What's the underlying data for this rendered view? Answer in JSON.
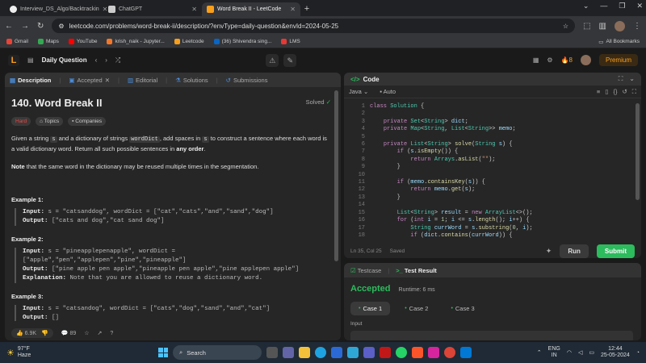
{
  "browser": {
    "tabs": [
      {
        "title": "Interview_DS_Algo/Backtrackin",
        "favicon_color": "#eeeeee",
        "active": false
      },
      {
        "title": "ChatGPT",
        "favicon_color": "#cccccc",
        "active": false
      },
      {
        "title": "Word Break II - LeetCode",
        "favicon_color": "#f89f1b",
        "active": true
      }
    ],
    "url": "leetcode.com/problems/word-break-ii/description/?envType=daily-question&envId=2024-05-25",
    "bookmarks": [
      {
        "label": "Gmail",
        "color": "#ea4335"
      },
      {
        "label": "Maps",
        "color": "#34a853"
      },
      {
        "label": "YouTube",
        "color": "#ff0000"
      },
      {
        "label": "krish_naik - Jupyter...",
        "color": "#f37726"
      },
      {
        "label": "Leetcode",
        "color": "#f89f1b"
      },
      {
        "label": "(36) Shivendra sing...",
        "color": "#0a66c2"
      },
      {
        "label": "LMS",
        "color": "#e53935"
      }
    ],
    "all_bookmarks": "All Bookmarks"
  },
  "lc_header": {
    "title": "Daily Question",
    "streak": "8",
    "premium": "Premium"
  },
  "left": {
    "tabs": [
      "Description",
      "Accepted",
      "Editorial",
      "Solutions",
      "Submissions"
    ],
    "problem_title": "140. Word Break II",
    "solved": "Solved",
    "badges": [
      "Hard",
      "Topics",
      "Companies"
    ],
    "desc": {
      "p1_a": "Given a string ",
      "p1_s": "s",
      "p1_b": " and a dictionary of strings ",
      "p1_dict": "wordDict",
      "p1_c": ", add spaces in ",
      "p1_s2": "s",
      "p1_d": " to construct a sentence where each word is a valid dictionary word. Return all such possible sentences in ",
      "p1_any": "any order",
      "p1_end": ".",
      "p2_note": "Note",
      "p2_rest": " that the same word in the dictionary may be reused multiple times in the segmentation."
    },
    "examples": [
      {
        "title": "Example 1:",
        "input": "s = \"catsanddog\", wordDict = [\"cat\",\"cats\",\"and\",\"sand\",\"dog\"]",
        "output": "[\"cats and dog\",\"cat sand dog\"]"
      },
      {
        "title": "Example 2:",
        "input_l1": "s = \"pineapplepenapple\", wordDict =",
        "input_l2": "[\"apple\",\"pen\",\"applepen\",\"pine\",\"pineapple\"]",
        "output": "[\"pine apple pen apple\",\"pineapple pen apple\",\"pine applepen apple\"]",
        "explanation": "Note that you are allowed to reuse a dictionary word."
      },
      {
        "title": "Example 3:",
        "input": "s = \"catsandog\", wordDict = [\"cats\",\"dog\",\"sand\",\"and\",\"cat\"]",
        "output": "[]"
      }
    ],
    "labels": {
      "input": "Input:",
      "output": "Output:",
      "explanation": "Explanation:"
    },
    "footer": {
      "likes": "6.9K",
      "comments": "89"
    }
  },
  "code": {
    "title": "Code",
    "language": "Java",
    "mode": "Auto",
    "line_numbers": "1\n2\n3\n4\n5\n6\n7\n8\n9\n10\n11\n12\n13\n14\n15\n16\n17\n18",
    "status_pos": "Ln 35, Col 25",
    "status_saved": "Saved",
    "run": "Run",
    "submit": "Submit"
  },
  "result": {
    "tabs": [
      "Testcase",
      "Test Result"
    ],
    "verdict": "Accepted",
    "runtime": "Runtime: 6 ms",
    "cases": [
      "Case 1",
      "Case 2",
      "Case 3"
    ],
    "input_label": "Input"
  },
  "taskbar": {
    "temp": "97°F",
    "weather": "Haze",
    "search": "Search",
    "lang_1": "ENG",
    "lang_2": "IN",
    "time": "12:44",
    "date": "25-05-2024"
  }
}
